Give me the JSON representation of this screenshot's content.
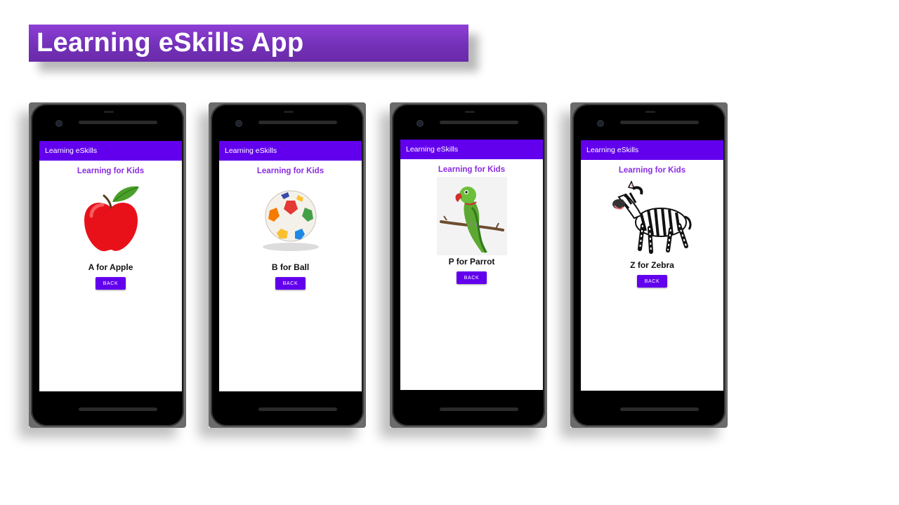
{
  "slide": {
    "title": "Learning eSkills App"
  },
  "phones": [
    {
      "app_bar_title": "Learning eSkills",
      "heading": "Learning for Kids",
      "caption": "A for Apple",
      "image_icon": "apple",
      "button_label": "BACK"
    },
    {
      "app_bar_title": "Learning eSkills",
      "heading": "Learning for Kids",
      "caption": "B for Ball",
      "image_icon": "soccer-ball",
      "button_label": "BACK"
    },
    {
      "app_bar_title": "Learning eSkills",
      "heading": "Learning for Kids",
      "caption": "P for Parrot",
      "image_icon": "parrot",
      "button_label": "BACK"
    },
    {
      "app_bar_title": "Learning eSkills",
      "heading": "Learning for Kids",
      "caption": "Z for Zebra",
      "image_icon": "zebra",
      "button_label": "BACK"
    }
  ],
  "colors": {
    "app_bar": "#6200ee",
    "heading_text": "#8a2be2",
    "button": "#6200ee",
    "banner": "#7431b8"
  }
}
